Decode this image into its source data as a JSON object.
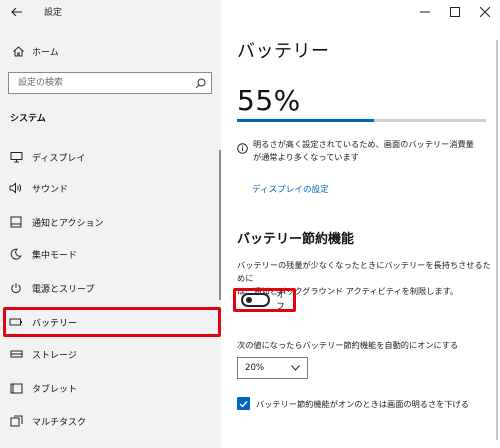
{
  "window": {
    "title": "設定",
    "controls": {
      "minimize": "—",
      "maximize": "☐",
      "close": "✕"
    }
  },
  "sidebar": {
    "home_label": "ホーム",
    "search_placeholder": "設定の検索",
    "section_title": "システム",
    "items": [
      {
        "label": "ディスプレイ",
        "icon": "display-icon"
      },
      {
        "label": "サウンド",
        "icon": "speaker-icon"
      },
      {
        "label": "通知とアクション",
        "icon": "notification-icon"
      },
      {
        "label": "集中モード",
        "icon": "moon-icon"
      },
      {
        "label": "電源とスリープ",
        "icon": "power-icon"
      },
      {
        "label": "バッテリー",
        "icon": "battery-icon",
        "selected": true
      },
      {
        "label": "ストレージ",
        "icon": "storage-icon"
      },
      {
        "label": "タブレット",
        "icon": "tablet-icon"
      },
      {
        "label": "マルチタスク",
        "icon": "multitask-icon"
      }
    ]
  },
  "main": {
    "title": "バッテリー",
    "percent_text": "55%",
    "battery_level": 0.55,
    "info_text_line1": "明るさが高く設定されているため、画面のバッテリー消費量",
    "info_text_line2": "が通常より多くなっています",
    "display_settings_link": "ディスプレイの設定",
    "saver_title": "バッテリー節約機能",
    "saver_desc_line1": "バッテリーの残量が少なくなったときにバッテリーを長持ちさせるために",
    "saver_desc_line2": "は、通知とバックグラウンド アクティビティを制限します。",
    "saver_toggle_label": "オフ",
    "saver_toggle_on": false,
    "threshold_label": "次の値になったらバッテリー節約機能を自動的にオンにする",
    "threshold_value": "20%",
    "brightness_checkbox_label": "バッテリー節約機能がオンのときは画面の明るさを下げる",
    "brightness_checkbox_checked": true
  },
  "colors": {
    "accent": "#0067c0",
    "highlight": "#e50012",
    "sidebar_bg": "#f2f2f2"
  }
}
